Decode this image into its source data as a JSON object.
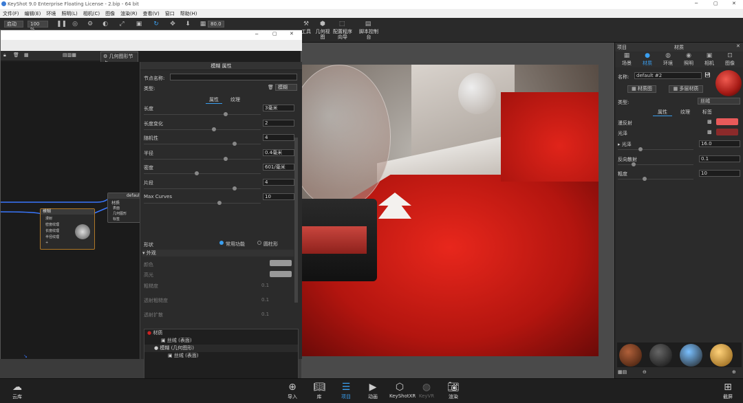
{
  "window": {
    "title": "KeyShot 9.0 Enterprise Floating License - 2.bip - 64 bit"
  },
  "menu": [
    "文件(F)",
    "编辑(E)",
    "环境",
    "照明(L)",
    "相机(C)",
    "图像",
    "渲染(R)",
    "查看(V)",
    "窗口",
    "帮助(H)"
  ],
  "toolbar": {
    "start": "启动",
    "zoom": "100 %",
    "fov": "80.0",
    "tools": "工具",
    "geometry_view": "几何视图",
    "config_wizard": "配置程序向导",
    "script_console": "脚本控制台"
  },
  "node_editor": {
    "add_node": "几何图形节点",
    "node_material": "材质",
    "node_default": "default",
    "node_texture": "模糊",
    "texture_ports": [
      "漫射",
      "密度纹理",
      "长度纹理",
      "半径纹理",
      "+"
    ],
    "material_ports": [
      "表面",
      "几何图形",
      "标签"
    ],
    "geometry_ports": [
      "表面"
    ]
  },
  "props": {
    "title": "模糊 属性",
    "node_name_label": "节点名称:",
    "type_label": "类型:",
    "type_value": "模糊",
    "tabs": [
      "属性",
      "纹理"
    ],
    "rows": [
      {
        "label": "长度",
        "value": "3毫米",
        "knob": 0.7
      },
      {
        "label": "长度变化",
        "value": "2",
        "knob": 0.6
      },
      {
        "label": "随机性",
        "value": "4",
        "knob": 0.78
      },
      {
        "label": "半径",
        "value": "0.4毫米",
        "knob": 0.7
      },
      {
        "label": "密度",
        "value": "601/毫米",
        "knob": 0.45
      },
      {
        "label": "片段",
        "value": "4",
        "knob": 0.78
      },
      {
        "label": "Max Curves",
        "value": "10",
        "knob": 0.65
      }
    ],
    "shape_label": "形状",
    "shape_opt1": "常用功能",
    "shape_opt2": "圆柱形",
    "appearance": "外观",
    "appearance_rows": [
      {
        "label": "颜色"
      },
      {
        "label": "高光"
      },
      {
        "label": "粗糙度",
        "value": "0.1"
      },
      {
        "label": "透射粗糙度",
        "value": "0.1"
      },
      {
        "label": "透射扩散",
        "value": "0.1"
      }
    ],
    "tree": [
      "材质",
      "丝绒 (表面)",
      "模糊 (几何图形)",
      "丝绒 (表面)"
    ]
  },
  "right_panel": {
    "header_left": "项目",
    "header_center": "材质",
    "tabs": [
      "场景",
      "材质",
      "环境",
      "照明",
      "相机",
      "图像"
    ],
    "name_label": "名称:",
    "name_value": "default #2",
    "btn_material_graph": "材质图",
    "btn_multilayer": "多层材质",
    "type_label": "类型:",
    "type_value": "丝绒",
    "subtabs": [
      "属性",
      "纹理",
      "标签"
    ],
    "diffuse": "漫反射",
    "sheen": "光泽",
    "sheen_val_label": "光泽",
    "sheen_val": "16.0",
    "backscatter": "反向散射",
    "backscatter_val": "0.1",
    "roughness": "粗度",
    "roughness_val": "10",
    "colors": {
      "diffuse": "#e85a5a",
      "sheen": "#8b2a2a"
    }
  },
  "bottom": {
    "cloud": "云库",
    "import": "导入",
    "library": "库",
    "project": "项目",
    "animation": "动画",
    "keyshotxr": "KeyShotXR",
    "keyvr": "KeyVR",
    "render": "渲染",
    "screenshot": "截屏"
  }
}
